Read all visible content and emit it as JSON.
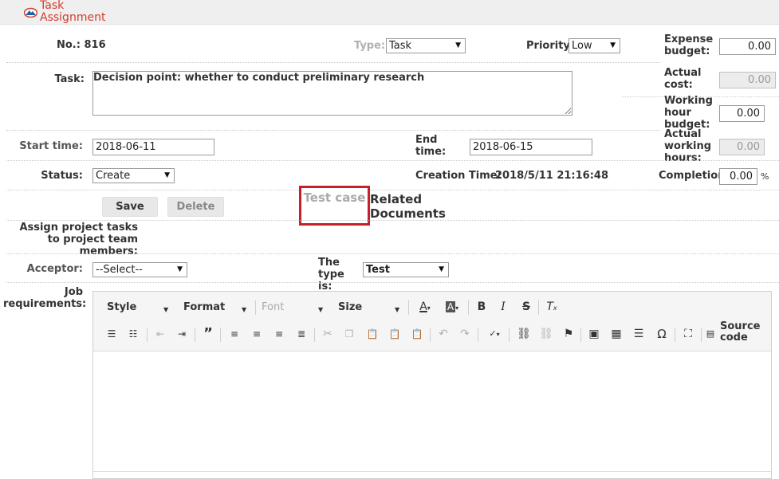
{
  "header": {
    "title": "Task Assignment"
  },
  "form": {
    "number_label": "No.: 816",
    "type_label": "Type:",
    "type_value": "Task",
    "priority_label": "Priority:",
    "priority_value": "Low",
    "expense_budget_label": "Expense budget:",
    "expense_budget_value": "0.00",
    "task_label": "Task:",
    "task_value": "Decision point: whether to conduct preliminary research",
    "actual_cost_label": "Actual cost:",
    "actual_cost_value": "0.00",
    "working_hour_budget_label": "Working hour budget:",
    "working_hour_budget_value": "0.00",
    "start_time_label": "Start time:",
    "start_time_value": "2018-06-11",
    "end_time_label": "End time:",
    "end_time_value": "2018-06-15",
    "actual_working_hours_label": "Actual working hours:",
    "actual_working_hours_value": "0.00",
    "status_label": "Status:",
    "status_value": "Create",
    "creation_time_label": "Creation Time:",
    "creation_time_value": "2018/5/11 21:16:48",
    "completion_label": "Completion:",
    "completion_value": "0.00",
    "completion_unit": "%",
    "assign_label": "Assign project tasks to project team members:",
    "acceptor_label": "Acceptor:",
    "acceptor_value": "--Select--",
    "the_type_is_label": "The type is:",
    "the_type_is_value": "Test",
    "job_requirements_label": "Job requirements:"
  },
  "buttons": {
    "save": "Save",
    "delete": "Delete",
    "test_case": "Test case",
    "related_documents": "Related Documents"
  },
  "editor": {
    "style": "Style",
    "format": "Format",
    "font": "Font",
    "size": "Size",
    "source_code": "Source code"
  },
  "icons": {
    "logo": "mountain-logo",
    "bold": "bold-icon",
    "italic": "italic-icon"
  },
  "colors": {
    "title": "#d23b2b",
    "highlight_border": "#c8202a"
  }
}
